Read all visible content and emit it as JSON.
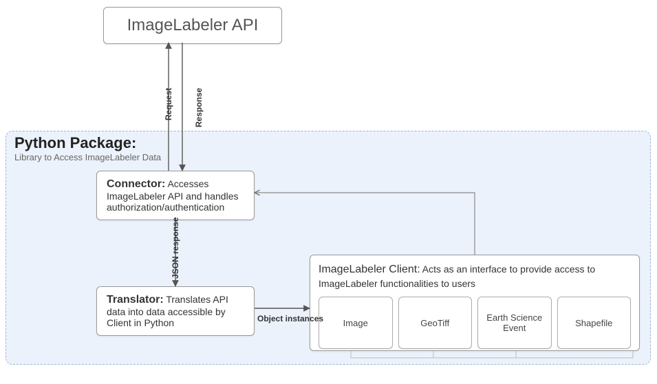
{
  "api": {
    "title": "ImageLabeler API"
  },
  "package": {
    "title": "Python Package:",
    "subtitle": "Library to Access ImageLabeler Data"
  },
  "connector": {
    "title": "Connector:",
    "desc": "Accesses ImageLabeler API and handles authorization/authentication"
  },
  "translator": {
    "title": "Translator:",
    "desc": "Translates API data into data accessible by Client in Python"
  },
  "client": {
    "title": "ImageLabeler Client:",
    "desc": "Acts as an interface to provide access to ImageLabeler functionalities to users",
    "items": [
      "Image",
      "GeoTiff",
      "Earth Science Event",
      "Shapefile"
    ]
  },
  "edges": {
    "request": "Request",
    "response": "Response",
    "json_response": "JSON response",
    "object_instances": "Object instances"
  }
}
